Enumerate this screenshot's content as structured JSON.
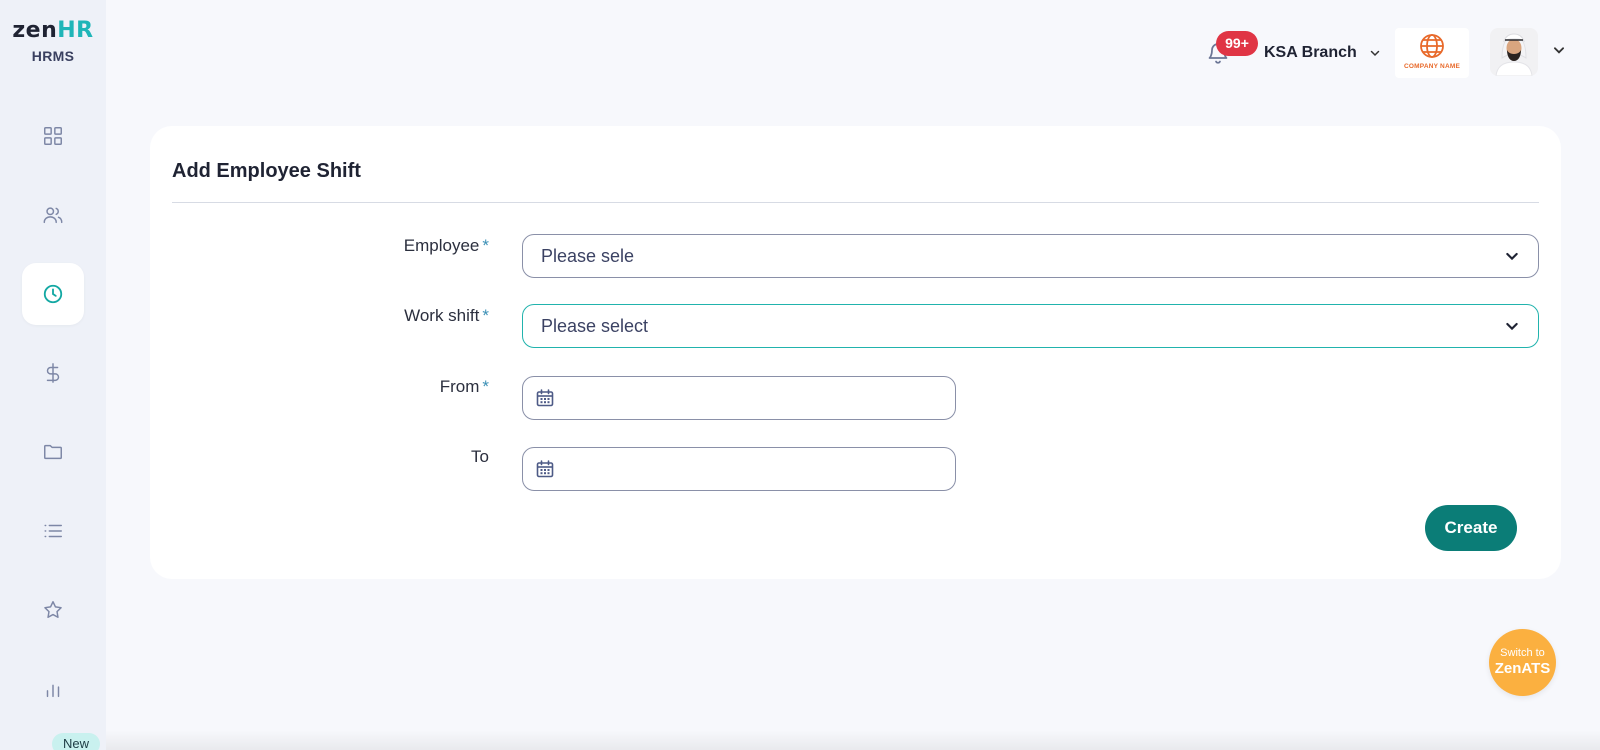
{
  "app": {
    "logo_prefix": "zen",
    "logo_suffix": "HR",
    "logo_sub": "HRMS"
  },
  "sidebar": {
    "items": [
      {
        "icon": "grid-icon",
        "active": false
      },
      {
        "icon": "users-icon",
        "active": false
      },
      {
        "icon": "clock-icon",
        "active": true
      },
      {
        "icon": "dollar-icon",
        "active": false
      },
      {
        "icon": "folder-icon",
        "active": false
      },
      {
        "icon": "list-icon",
        "active": false
      },
      {
        "icon": "star-icon",
        "active": false
      },
      {
        "icon": "bar-chart-icon",
        "active": false
      }
    ],
    "new_badge": "New"
  },
  "header": {
    "notification_count": "99+",
    "branch": "KSA Branch",
    "company_name": "COMPANY NAME"
  },
  "form": {
    "title": "Add Employee Shift",
    "required_marker": "*",
    "fields": {
      "employee": {
        "label": "Employee",
        "value": "Please sele"
      },
      "work_shift": {
        "label": "Work shift",
        "value": "Please select"
      },
      "from": {
        "label": "From",
        "value": ""
      },
      "to": {
        "label": "To",
        "value": ""
      }
    },
    "submit_label": "Create"
  },
  "switch": {
    "line1": "Switch to",
    "line2": "ZenATS"
  },
  "colors": {
    "accent": "#0b7d77",
    "teal": "#1fb5b8",
    "badge_red": "#e03545",
    "switch_orange": "#fbb040"
  }
}
